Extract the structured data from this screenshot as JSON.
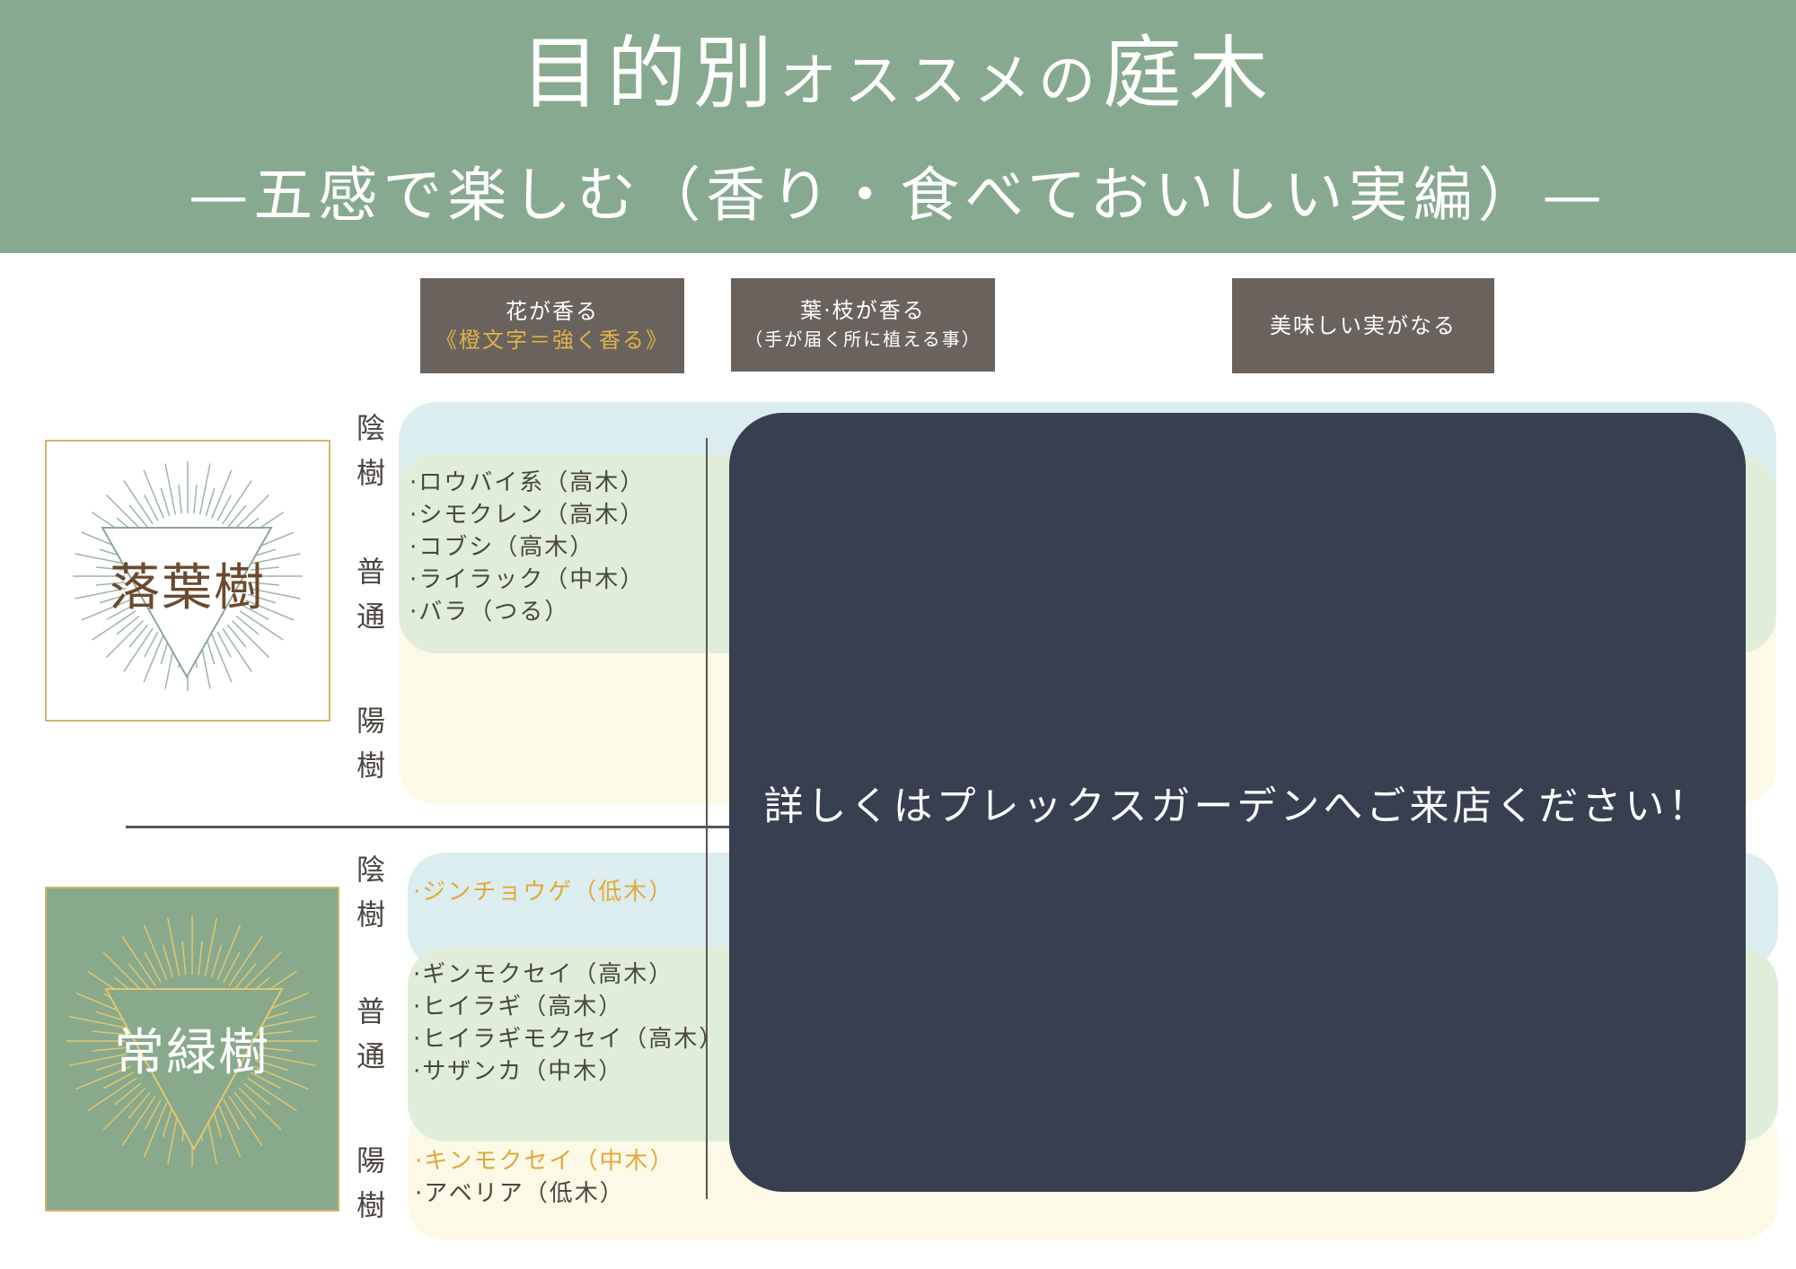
{
  "header": {
    "title_main": "目的別",
    "title_small": "オススメの",
    "title_end": "庭木",
    "subtitle": "—五感で楽しむ（香り・食べておいしい実編）—"
  },
  "columns": [
    {
      "line1": "花が香る",
      "line2": "《橙文字＝強く香る》"
    },
    {
      "line1": "葉·枝が香る",
      "line2": "（手が届く所に植える事）"
    },
    {
      "line1": "美味しい実がなる"
    }
  ],
  "sections": {
    "deciduous": {
      "label": "落葉樹",
      "rows": {
        "shade": "陰樹",
        "normal": "普通",
        "sun": "陽樹"
      },
      "flowers": [
        "·ロウバイ系（高木）",
        "·シモクレン（高木）",
        "·コブシ（高木）",
        "·ライラック（中木）",
        "·バラ（つる）"
      ]
    },
    "evergreen": {
      "label": "常緑樹",
      "rows": {
        "shade": "陰樹",
        "normal": "普通",
        "sun": "陽樹"
      },
      "shade_flowers": [
        "·ジンチョウゲ（低木）"
      ],
      "normal_flowers": [
        "·ギンモクセイ（高木）",
        "·ヒイラギ（高木）",
        "·ヒイラギモクセイ（高木）",
        "·サザンカ（中木）"
      ],
      "sun_flowers": [
        "·キンモクセイ（中木）",
        "·アベリア（低木）"
      ]
    }
  },
  "overlay": {
    "message": "詳しくはプレックスガーデンへご来店ください！"
  },
  "colors": {
    "header": "#87a990",
    "header_box": "#6a625d",
    "accent_orange": "#e0a93a",
    "band_blue": "#dcedef",
    "band_green": "#e0eed9",
    "band_cream": "#fcf9e6",
    "overlay": "#373f50"
  }
}
